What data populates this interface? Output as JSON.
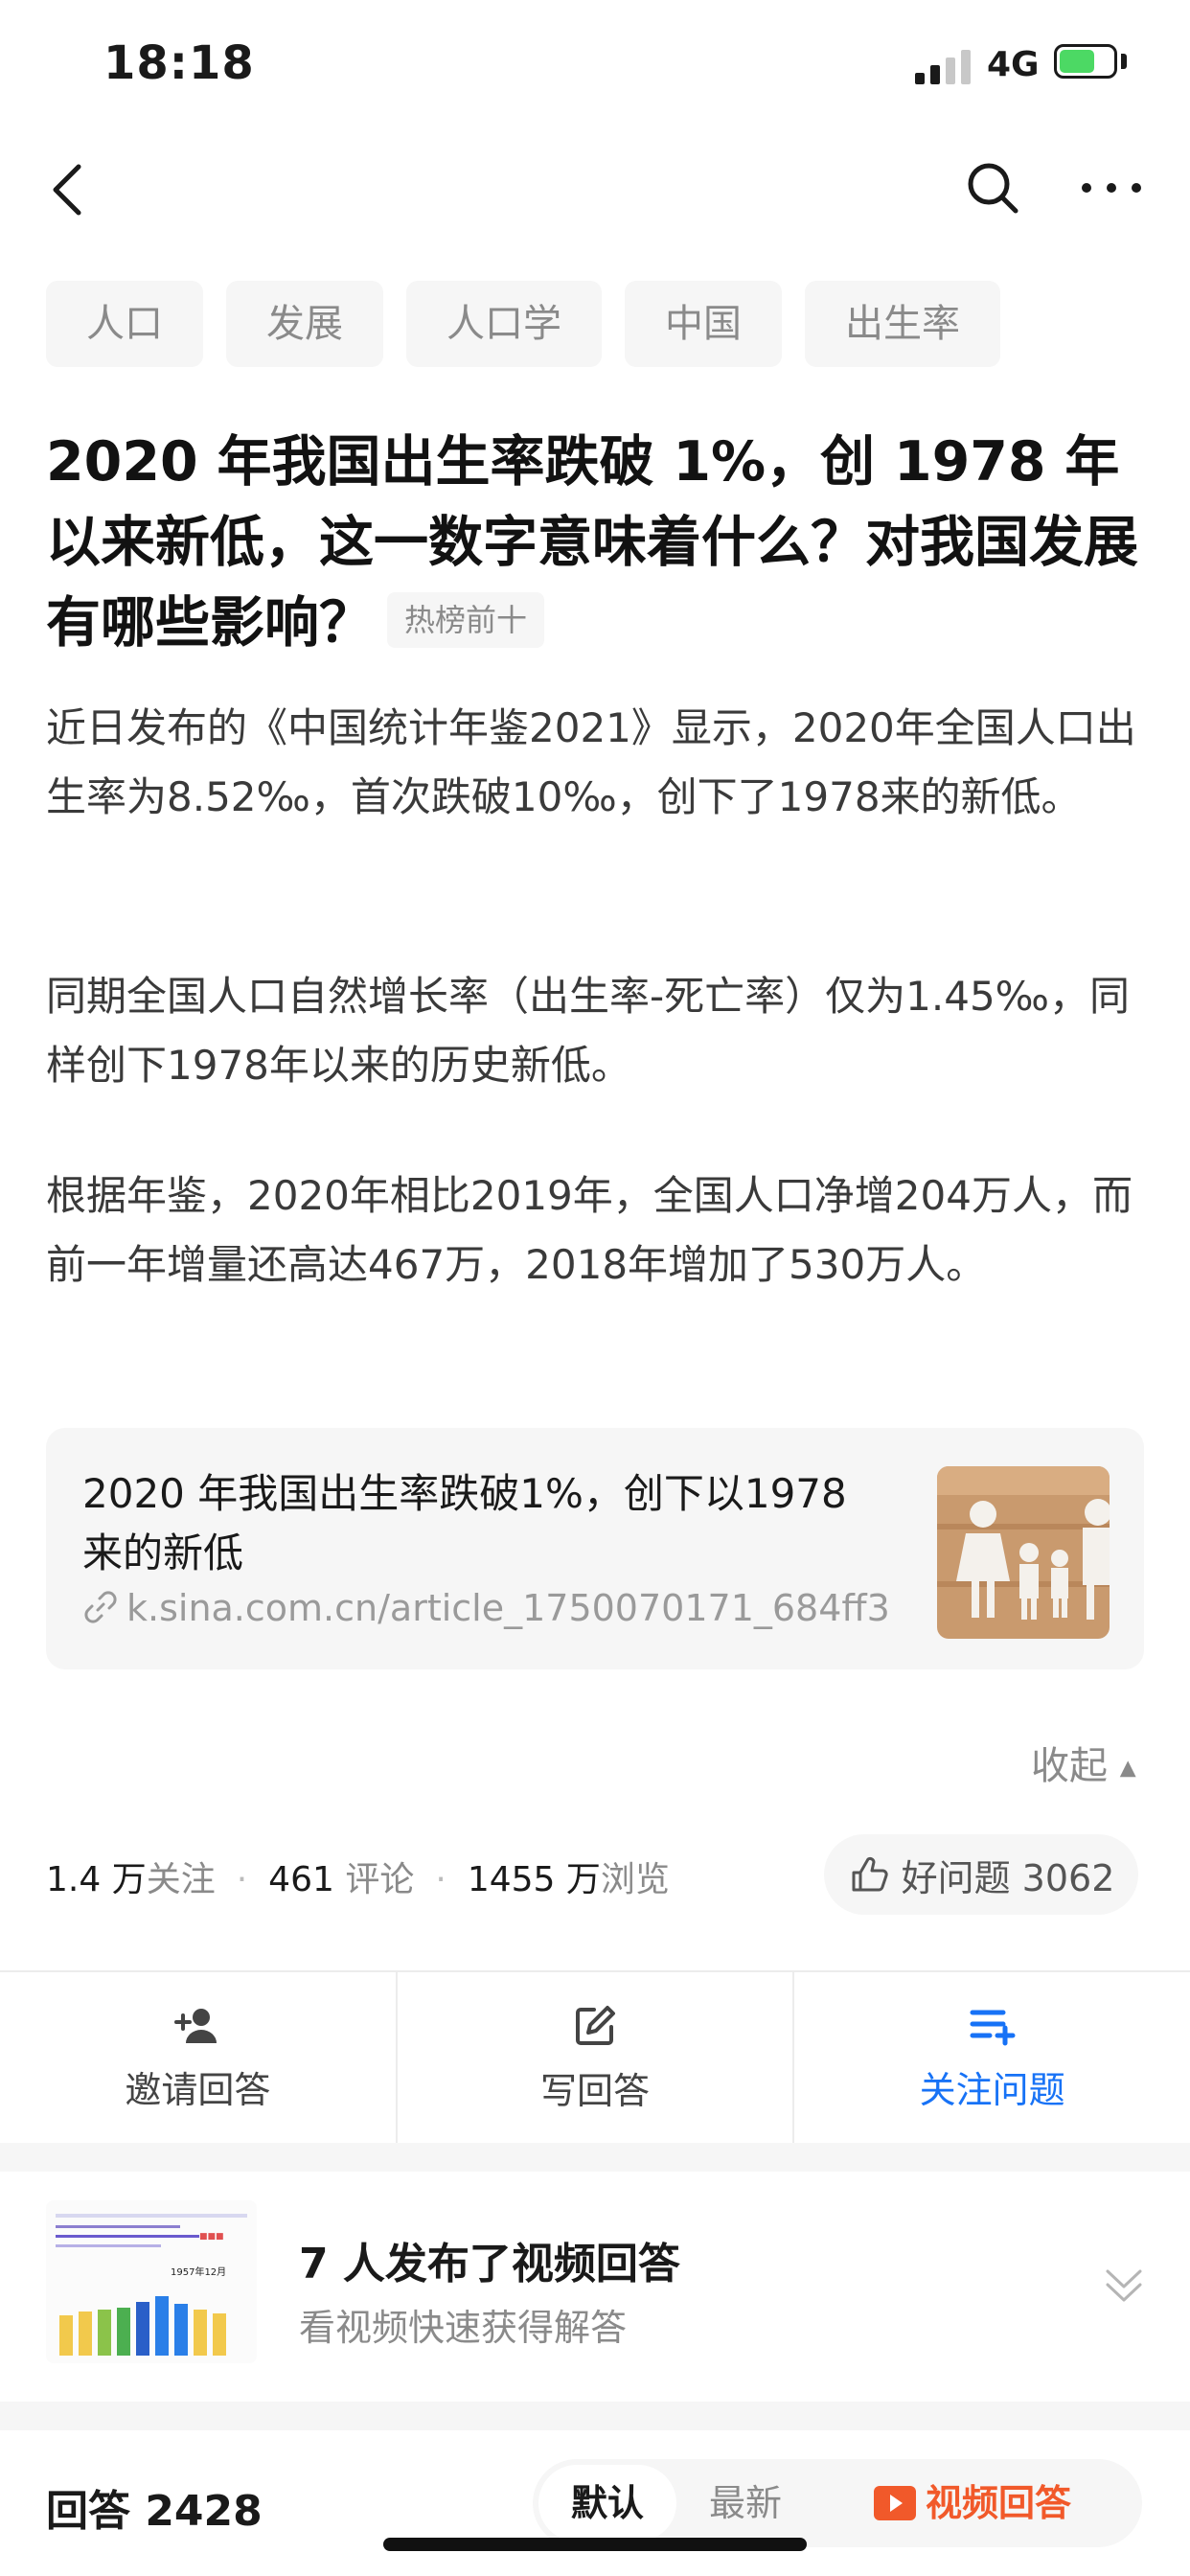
{
  "status_bar": {
    "time": "18:18",
    "network": "4G",
    "battery_level": 0.7
  },
  "tags": [
    "人口",
    "发展",
    "人口学",
    "中国",
    "出生率"
  ],
  "question": {
    "title": "2020 年我国出生率跌破 1%，创 1978 年以来新低，这一数字意味着什么？对我国发展有哪些影响？",
    "badge": "热榜前十",
    "paragraphs": [
      "近日发布的《中国统计年鉴2021》显示，2020年全国人口出生率为8.52‰，首次跌破10‰，创下了1978来的新低。",
      "同期全国人口自然增长率（出生率-死亡率）仅为1.45‰，同样创下1978年以来的历史新低。",
      "根据年鉴，2020年相比2019年，全国人口净增204万人，而前一年增量还高达467万，2018年增加了530万人。"
    ],
    "link_card": {
      "title": "2020 年我国出生率跌破1%，创下以1978来的新低",
      "url": "k.sina.com.cn/article_1750070171_684ff3..."
    },
    "collapse_label": "收起"
  },
  "stats": {
    "follow_count": "1.4 万",
    "follow_label": "关注",
    "comment_count": "461",
    "comment_label": "评论",
    "view_count": "1455 万",
    "view_label": "浏览",
    "good_question": "好问题 3062"
  },
  "actions": [
    {
      "label": "邀请回答",
      "icon": "invite-user-icon"
    },
    {
      "label": "写回答",
      "icon": "edit-icon"
    },
    {
      "label": "关注问题",
      "icon": "follow-list-icon"
    }
  ],
  "video_answers": {
    "title": "7 人发布了视频回答",
    "subtitle": "看视频快速获得解答",
    "thumb_label": "1957年12月"
  },
  "answers": {
    "label": "回答 2428",
    "sort_options": [
      "默认",
      "最新"
    ],
    "video_sort": "视频回答"
  },
  "colors": {
    "accent_blue": "#1772f6",
    "video_orange": "#f1592a",
    "tag_bg": "#f6f6f6"
  }
}
